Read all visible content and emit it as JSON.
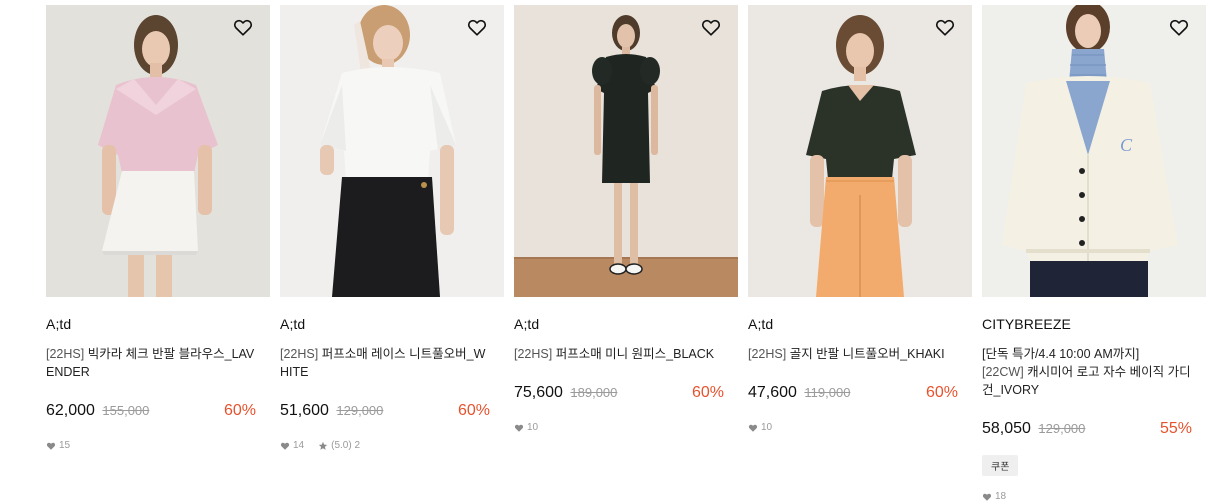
{
  "products": [
    {
      "brand": "A;td",
      "title_prefix": "[22HS]",
      "title": "빅카라 체크 반팔 블라우스_LAVENDER",
      "price": "62,000",
      "original_price": "155,000",
      "discount": "60%",
      "likes": "15",
      "colors": {
        "bg": "#e7e4df",
        "top": "#e8c2cf",
        "bottom": "#f4f3f0"
      }
    },
    {
      "brand": "A;td",
      "title_prefix": "[22HS]",
      "title": "퍼프소매 레이스 니트풀오버_WHITE",
      "price": "51,600",
      "original_price": "129,000",
      "discount": "60%",
      "likes": "14",
      "rating": "(5.0) 2",
      "colors": {
        "bg": "#f0efed",
        "top": "#f7f7f6",
        "bottom": "#1c1c1e"
      }
    },
    {
      "brand": "A;td",
      "title_prefix": "[22HS]",
      "title": "퍼프소매 미니 원피스_BLACK",
      "price": "75,600",
      "original_price": "189,000",
      "discount": "60%",
      "likes": "10",
      "colors": {
        "bg": "#e8e2da",
        "floor": "#b98a62",
        "dress": "#1f2521"
      }
    },
    {
      "brand": "A;td",
      "title_prefix": "[22HS]",
      "title": "골지 반팔 니트풀오버_KHAKI",
      "price": "47,600",
      "original_price": "119,000",
      "discount": "60%",
      "likes": "10",
      "colors": {
        "bg": "#ebe8e4",
        "top": "#2b3329",
        "bottom": "#f2ab6c"
      }
    },
    {
      "brand": "CITYBREEZE",
      "title_line1": "[단독 특가/4.4 10:00 AM까지]",
      "title_prefix": "[22CW]",
      "title": "캐시미어 로고 자수 베이직 가디건_IVORY",
      "price": "58,050",
      "original_price": "129,000",
      "discount": "55%",
      "coupon": "쿠폰",
      "likes": "18",
      "colors": {
        "bg": "#efefec",
        "top": "#f4f1e4",
        "turtle": "#8aa6cf",
        "bottom": "#1f2536"
      }
    }
  ],
  "icons": {
    "wishlist": "heart-outline-icon",
    "likes": "heart-filled-icon",
    "rating": "star-icon"
  },
  "accent": {
    "discount": "#e5532e",
    "strike": "#9b9b9b"
  }
}
